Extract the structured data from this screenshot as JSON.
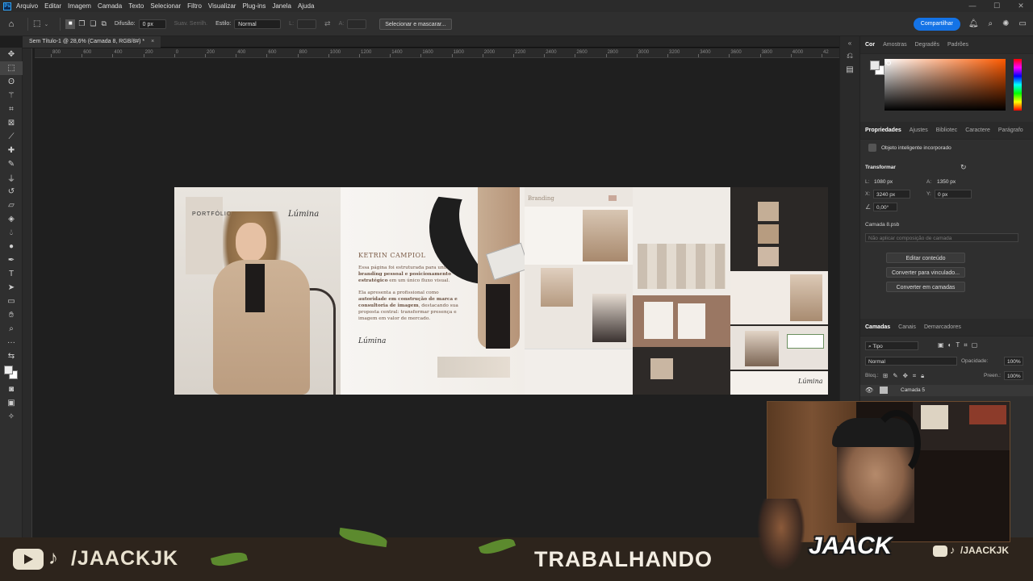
{
  "menu": {
    "app_logo": "Ps",
    "items": [
      "Arquivo",
      "Editar",
      "Imagem",
      "Camada",
      "Texto",
      "Selecionar",
      "Filtro",
      "Visualizar",
      "Plug-ins",
      "Janela",
      "Ajuda"
    ],
    "window_controls": [
      "—",
      "☐",
      "✕"
    ]
  },
  "options": {
    "difusao_label": "Difusão:",
    "difusao_value": "0 px",
    "suav_label": "Suav. Serrilh.",
    "estilo_label": "Estilo:",
    "estilo_value": "Normal",
    "l_label": "L:",
    "a_label": "A:",
    "select_mask_button": "Selecionar e mascarar...",
    "share_button": "Compartilhar"
  },
  "document": {
    "tab_title": "Sem Título-1 @ 28,6% (Camada 8, RGB/8#) *",
    "close": "×"
  },
  "ruler": {
    "h_labels": [
      "800",
      "600",
      "400",
      "200",
      "0",
      "200",
      "400",
      "600",
      "800",
      "1000",
      "1200",
      "1400",
      "1600",
      "1800",
      "2000",
      "2200",
      "2400",
      "2600",
      "2800",
      "3000",
      "3200",
      "3400",
      "3600",
      "3800",
      "4000",
      "42"
    ]
  },
  "artwork": {
    "portfolio_label": "PORTFÓLIO",
    "brand": "Lúmina",
    "name_heading": "KETRIN CAMPIOL",
    "paragraph1_a": "Essa página foi estruturada para unir ",
    "paragraph1_b": "branding pessoal e posicionamento estratégico",
    "paragraph1_c": " em um único fluxo visual.",
    "paragraph2_a": "Ela apresenta a profissional como ",
    "paragraph2_b": "autoridade em construção de marca e consultoria de imagem",
    "paragraph2_c": ", destacando sua proposta central: transformar presença e imagem em valor de mercado.",
    "signature": "Lúmina",
    "branding_label": "Branding"
  },
  "right_panel": {
    "color_tabs": [
      "Cor",
      "Amostras",
      "Degradês",
      "Padrões"
    ],
    "props_tabs": [
      "Propriedades",
      "Ajustes",
      "Bibliotec",
      "Caractere",
      "Parágrafo"
    ],
    "object_type": "Objeto inteligente incorporado",
    "transform_title": "Transformar",
    "l_label": "L:",
    "l_value": "1080 px",
    "a_label": "A:",
    "a_value": "1350 px",
    "x_label": "X:",
    "x_value": "3240 px",
    "y_label": "Y:",
    "y_value": "0 px",
    "angle_value": "0,00°",
    "layer_file": "Camada 8.psb",
    "comp_placeholder": "Não aplicar composição de camada",
    "btn_edit": "Editar conteúdo",
    "btn_convert_linked": "Converter para vinculado...",
    "btn_convert_layers": "Converter em camadas",
    "layers_tabs": [
      "Camadas",
      "Canais",
      "Demarcadores"
    ],
    "kind_filter": "Tipo",
    "blend_mode": "Normal",
    "opacity_label": "Opacidade:",
    "opacity_value": "100%",
    "lock_label": "Bloq.:",
    "fill_label": "Preen.:",
    "fill_value": "100%",
    "layer_name": "Camada 5"
  },
  "overlay": {
    "youtube_icon": "youtube-icon",
    "tiktok_icon": "tiktok-icon",
    "handle": "/JAACKJK",
    "status": "TRABALHANDO",
    "logo": "JAACK",
    "handle_small": "/JAACKJK"
  },
  "colors": {
    "accent": "#1473e6",
    "ps_blue": "#31a8ff",
    "artwork_beige": "#c9b29a",
    "artwork_brown": "#7a5a45"
  }
}
